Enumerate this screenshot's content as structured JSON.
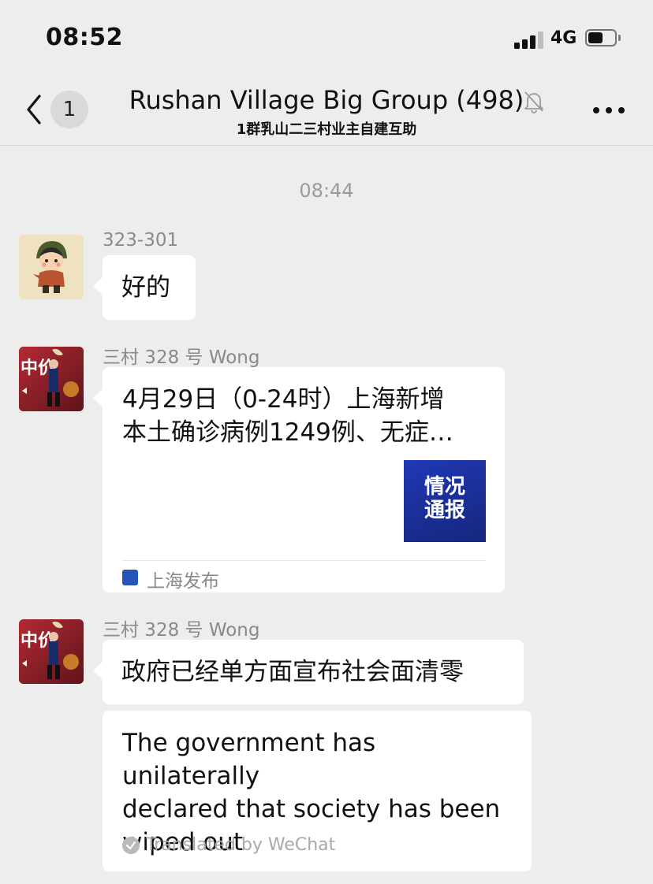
{
  "status_bar": {
    "time": "08:52",
    "network": "4G"
  },
  "nav": {
    "unread_count": "1",
    "title": "Rushan Village Big Group (498)",
    "subtitle": "1群乳山二三村业主自建互助",
    "icons": [
      "back-chevron-icon",
      "mute-bell-icon",
      "more-icon"
    ]
  },
  "chat": {
    "timestamp": "08:44",
    "messages": [
      {
        "sender": "323-301",
        "text": "好的"
      },
      {
        "sender": "三村 328 号 Wong",
        "card": {
          "title_line1": "4月29日（0-24时）上海新增",
          "title_line2": "本土确诊病例1249例、无症…",
          "thumb_line1": "情况",
          "thumb_line2": "通报",
          "source": "上海发布"
        }
      },
      {
        "sender": "三村 328 号 Wong",
        "text": "政府已经单方面宣布社会面清零",
        "translation": {
          "line1": "The government has unilaterally",
          "line2": "declared that society has been",
          "line3": "wiped out",
          "by": "Translated by WeChat"
        }
      }
    ]
  },
  "colors": {
    "background": "#ededed",
    "bubble": "#ffffff",
    "thumb_blue": "#1e2f9e"
  }
}
